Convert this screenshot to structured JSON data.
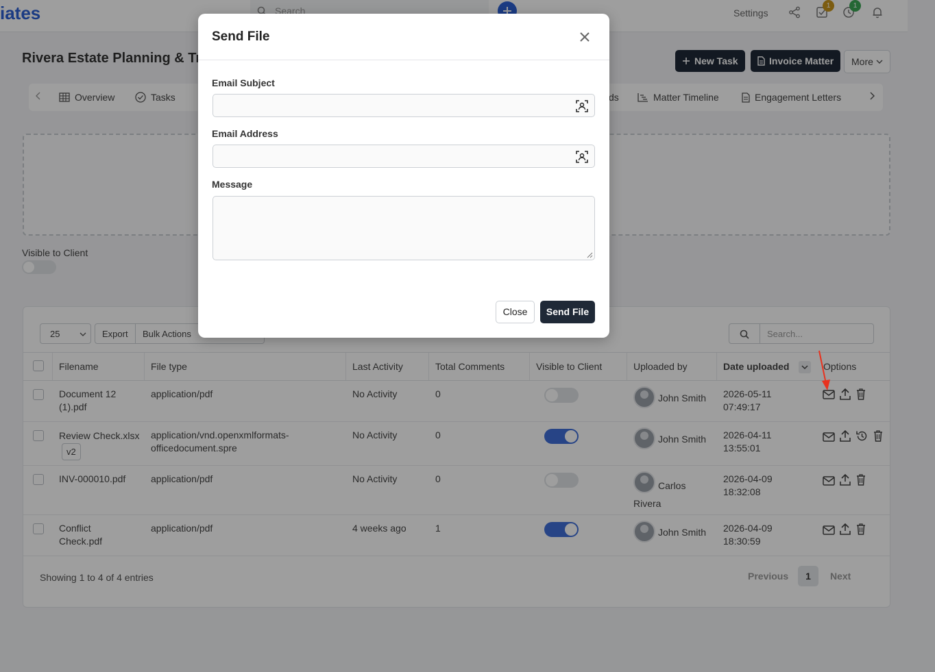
{
  "topbar": {
    "brand": "iates",
    "search_placeholder": "Search",
    "settings_label": "Settings",
    "tasks_badge": "1",
    "timer_badge": "1",
    "badge_colors": {
      "tasks": "#c9951b",
      "timer": "#3aa655"
    },
    "icons": [
      "search-icon",
      "plus-icon",
      "share-icon",
      "tasks-check-icon",
      "clock-icon",
      "bell-icon"
    ]
  },
  "page": {
    "title": "Rivera Estate Planning & Tru",
    "actions": {
      "new_task": "New Task",
      "invoice_matter": "Invoice Matter",
      "more": "More"
    }
  },
  "tabs": {
    "items": [
      {
        "label": "Overview",
        "icon": "grid-icon"
      },
      {
        "label": "Tasks",
        "icon": "check-circle-icon"
      },
      {
        "label": "ds",
        "icon": ""
      },
      {
        "label": "Matter Timeline",
        "icon": "timeline-icon"
      },
      {
        "label": "Engagement Letters",
        "icon": "document-icon"
      }
    ]
  },
  "upload": {
    "visible_label": "Visible to Client"
  },
  "table": {
    "page_length": "25",
    "export_label": "Export",
    "bulk_label": "Bulk Actions",
    "search_placeholder": "Search...",
    "columns": [
      "Filename",
      "File type",
      "Last Activity",
      "Total Comments",
      "Visible to Client",
      "Uploaded by",
      "Date uploaded",
      "Options"
    ],
    "rows": [
      {
        "filename": "Document 12 (1).pdf",
        "version": "",
        "type": "application/pdf",
        "activity": "No Activity",
        "comments": "0",
        "visible": false,
        "uploader": "John Smith",
        "date": "2026-05-11 07:49:17",
        "actions": [
          "mail-icon",
          "upload-icon",
          "trash-icon"
        ]
      },
      {
        "filename": "Review Check.xlsx",
        "version": "v2",
        "type": "application/vnd.openxmlformats-officedocument.spre",
        "activity": "No Activity",
        "comments": "0",
        "visible": true,
        "uploader": "John Smith",
        "date": "2026-04-11 13:55:01",
        "actions": [
          "mail-icon",
          "upload-icon",
          "history-icon",
          "trash-icon"
        ]
      },
      {
        "filename": "INV-000010.pdf",
        "version": "",
        "type": "application/pdf",
        "activity": "No Activity",
        "comments": "0",
        "visible": false,
        "uploader": "Carlos Rivera",
        "date": "2026-04-09 18:32:08",
        "actions": [
          "mail-icon",
          "upload-icon",
          "trash-icon"
        ]
      },
      {
        "filename": "Conflict Check.pdf",
        "version": "",
        "type": "application/pdf",
        "activity": "4 weeks ago",
        "comments": "1",
        "visible": true,
        "uploader": "John Smith",
        "date": "2026-04-09 18:30:59",
        "actions": [
          "mail-icon",
          "upload-icon",
          "trash-icon"
        ]
      }
    ],
    "info": "Showing 1 to 4 of 4 entries",
    "pagination": {
      "previous": "Previous",
      "current": "1",
      "next": "Next"
    }
  },
  "modal": {
    "title": "Send File",
    "fields": {
      "subject_label": "Email Subject",
      "subject_value": "",
      "email_label": "Email Address",
      "email_value": "",
      "message_label": "Message",
      "message_value": ""
    },
    "close_label": "Close",
    "send_label": "Send File"
  },
  "colors": {
    "accent": "#2c5fd4",
    "dark_button": "#1f2937",
    "toggle_on": "#3f6fd8",
    "annotation_arrow": "#e8321e"
  }
}
